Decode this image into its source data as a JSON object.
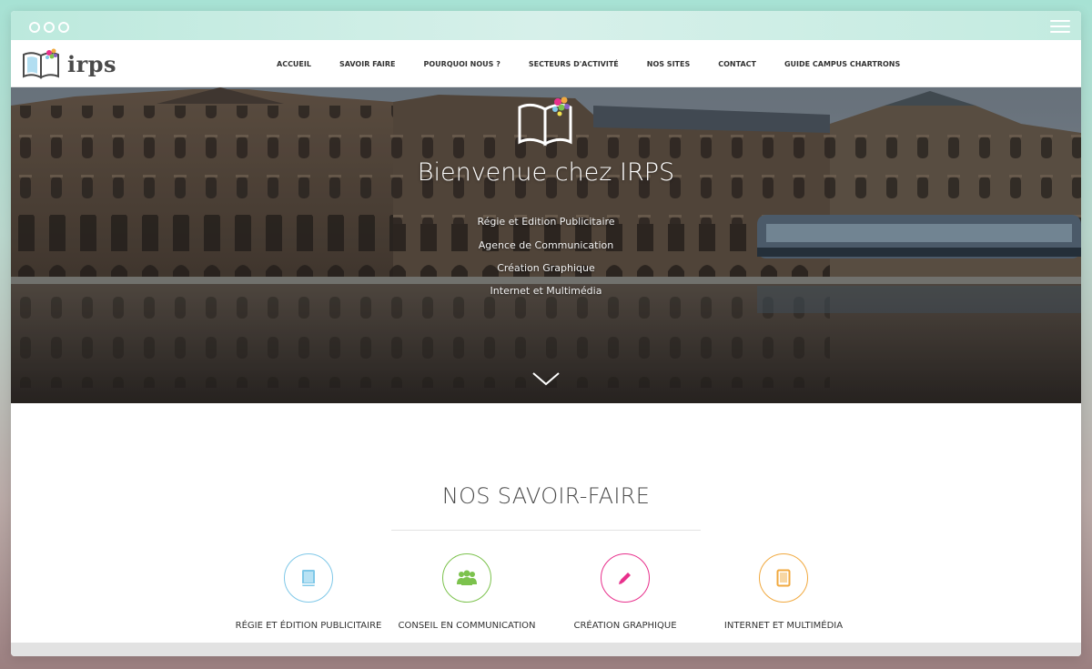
{
  "brand": {
    "name": "irps",
    "colors": {
      "dark": "#4a4a4a",
      "blue": "#7fc8e8",
      "green": "#7cc24d",
      "pink": "#e8308c",
      "orange": "#f1a93f"
    }
  },
  "chrome": {
    "icons": [
      "window-dot-icon",
      "hamburger-menu-icon"
    ]
  },
  "nav": {
    "items": [
      {
        "label": "ACCUEIL"
      },
      {
        "label": "SAVOIR FAIRE"
      },
      {
        "label": "POURQUOI NOUS ?"
      },
      {
        "label": "SECTEURS D'ACTIVITÉ"
      },
      {
        "label": "NOS SITES"
      },
      {
        "label": "CONTACT"
      },
      {
        "label": "GUIDE CAMPUS CHARTRONS"
      }
    ]
  },
  "hero": {
    "title": "Bienvenue chez IRPS",
    "subtitles": [
      "Régie et Edition Publicitaire",
      "Agence de Communication",
      "Création Graphique",
      "Internet et Multimédia"
    ],
    "icon": "book-logo-icon",
    "scroll_icon": "chevron-down-icon"
  },
  "section": {
    "title": "NOS SAVOIR-FAIRE",
    "features": [
      {
        "label": "RÉGIE ET ÉDITION PUBLICITAIRE",
        "icon": "book-icon",
        "color": "#7fc8e8"
      },
      {
        "label": "CONSEIL EN COMMUNICATION",
        "icon": "users-icon",
        "color": "#7cc24d"
      },
      {
        "label": "CRÉATION GRAPHIQUE",
        "icon": "pencil-icon",
        "color": "#e8308c"
      },
      {
        "label": "INTERNET ET MULTIMÉDIA",
        "icon": "tablet-icon",
        "color": "#f1a93f"
      }
    ]
  }
}
